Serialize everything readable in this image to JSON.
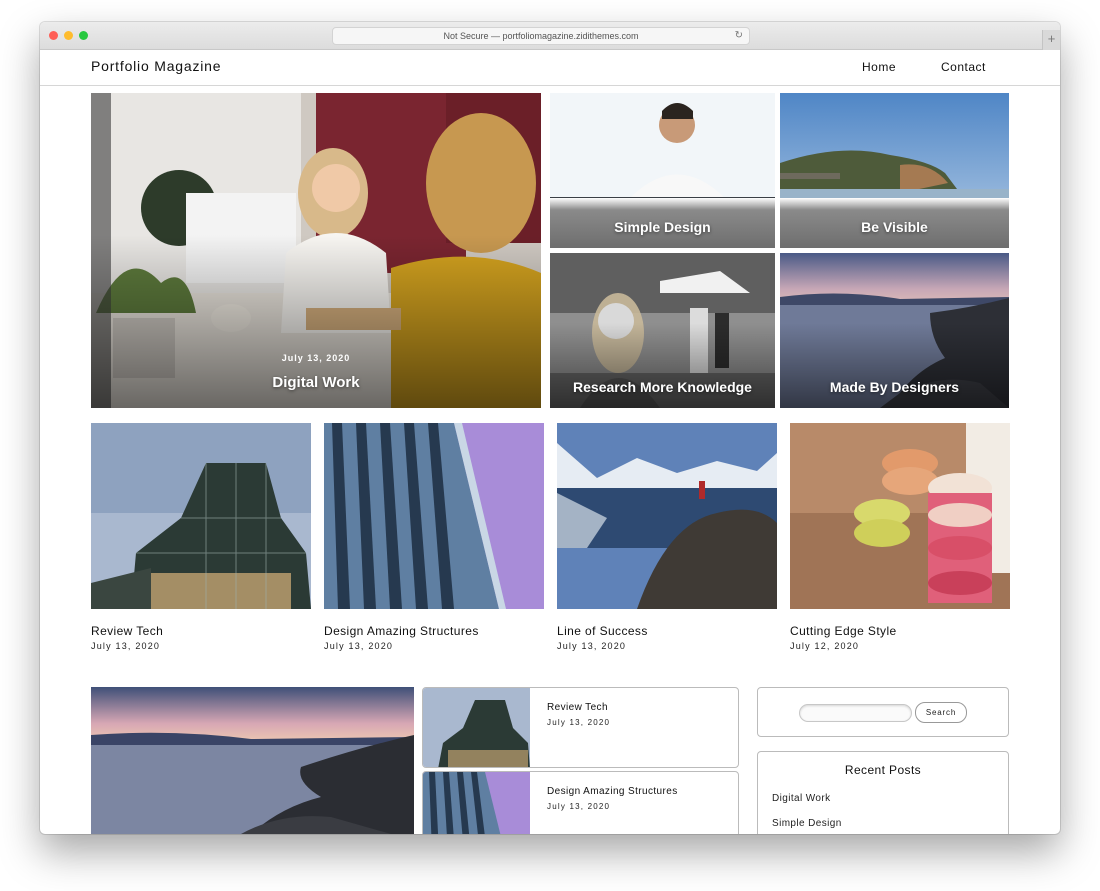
{
  "browser": {
    "url_text": "Not Secure — portfoliomagazine.zidithemes.com",
    "newtab_glyph": "+",
    "reload_glyph": "↻"
  },
  "header": {
    "brand": "Portfolio Magazine",
    "nav": {
      "home": "Home",
      "contact": "Contact"
    }
  },
  "hero": {
    "main": {
      "date": "July 13, 2020",
      "title": "Digital Work"
    },
    "tiles": [
      {
        "title": "Simple Design"
      },
      {
        "title": "Be Visible"
      },
      {
        "title": "Research More Knowledge"
      },
      {
        "title": "Made By Designers"
      }
    ]
  },
  "cards": [
    {
      "title": "Review Tech",
      "date": "July 13, 2020"
    },
    {
      "title": "Design Amazing Structures",
      "date": "July 13, 2020"
    },
    {
      "title": "Line of Success",
      "date": "July 13, 2020"
    },
    {
      "title": "Cutting Edge Style",
      "date": "July 12, 2020"
    }
  ],
  "side_list": [
    {
      "title": "Review Tech",
      "date": "July 13, 2020"
    },
    {
      "title": "Design Amazing Structures",
      "date": "July 13, 2020"
    }
  ],
  "sidebar": {
    "search": {
      "placeholder": "",
      "button": "Search"
    },
    "recent": {
      "title": "Recent Posts",
      "items": [
        "Digital Work",
        "Simple Design"
      ]
    }
  }
}
